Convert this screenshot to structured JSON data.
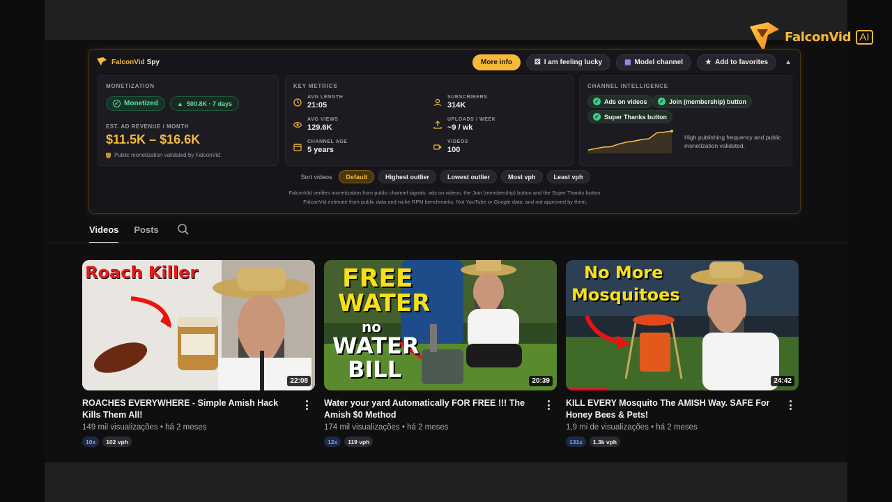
{
  "brand": {
    "name": "FalconVid",
    "ai_badge": "AI"
  },
  "spy": {
    "title_brand": "FalconVid",
    "title_suffix": "Spy",
    "actions": {
      "more_info": "More info",
      "lucky": "I am feeling lucky",
      "model": "Model channel",
      "favorites": "Add to favorites"
    },
    "monetization": {
      "title": "MONETIZATION",
      "status": "Monetized",
      "growth": "500.8K · 7 days",
      "revenue_label": "EST. AD REVENUE / MONTH",
      "revenue_value": "$11.5K – $16.6K",
      "note": "Public monetization validated by FalconVid."
    },
    "metrics": {
      "title": "KEY METRICS",
      "avg_length_label": "AVG LENGTH",
      "avg_length": "21:05",
      "subscribers_label": "SUBSCRIBERS",
      "subscribers": "314K",
      "avg_views_label": "AVG VIEWS",
      "avg_views": "129.6K",
      "uploads_label": "UPLOADS / WEEK",
      "uploads": "~9 / wk",
      "channel_age_label": "CHANNEL AGE",
      "channel_age": "5 years",
      "videos_label": "VIDEOS",
      "videos": "100"
    },
    "intelligence": {
      "title": "CHANNEL INTELLIGENCE",
      "chips": [
        "Ads on videos",
        "Join (membership) button",
        "Super Thanks button"
      ],
      "summary": "High publishing frequency and public monetization validated.",
      "trend": [
        0.15,
        0.22,
        0.28,
        0.3,
        0.42,
        0.5,
        0.55,
        0.62,
        0.66,
        0.92,
        0.95,
        1.0
      ]
    },
    "sort": {
      "label": "Sort videos",
      "options": [
        "Default",
        "Highest outlier",
        "Lowest outlier",
        "Most vph",
        "Least vph"
      ],
      "active": "Default"
    },
    "notes": {
      "line1": "FalconVid verifies monetization from public channel signals: ads on videos, the Join (membership) button and the Super Thanks button.",
      "line2": "FalconVid estimate from public data and niche RPM benchmarks. Not YouTube or Google data, and not approved by them."
    }
  },
  "tabs": {
    "videos": "Videos",
    "posts": "Posts"
  },
  "videos": [
    {
      "title": "ROACHES EVERYWHERE - Simple Amish Hack Kills Them All!",
      "meta": "149 mil visualizações • há 2 meses",
      "duration": "22:08",
      "outlier": "10x",
      "vph": "102 vph",
      "thumb_text": "Roach Killer"
    },
    {
      "title": "Water your yard Automatically FOR FREE !!! The Amish $0 Method",
      "meta": "174 mil visualizações • há 2 meses",
      "duration": "20:39",
      "outlier": "12x",
      "vph": "119 vph",
      "thumb_text_1": "FREE",
      "thumb_text_2": "WATER",
      "thumb_text_3": "no",
      "thumb_text_4": "WATER",
      "thumb_text_5": "BILL"
    },
    {
      "title": "KILL EVERY Mosquito The AMISH Way. SAFE For Honey Bees & Pets!",
      "meta": "1,9 mi de visualizações • há 2 meses",
      "duration": "24:42",
      "outlier": "131x",
      "vph": "1.3k vph",
      "watched": 0.18,
      "thumb_text_1": "No More",
      "thumb_text_2": "Mosquitoes"
    }
  ]
}
